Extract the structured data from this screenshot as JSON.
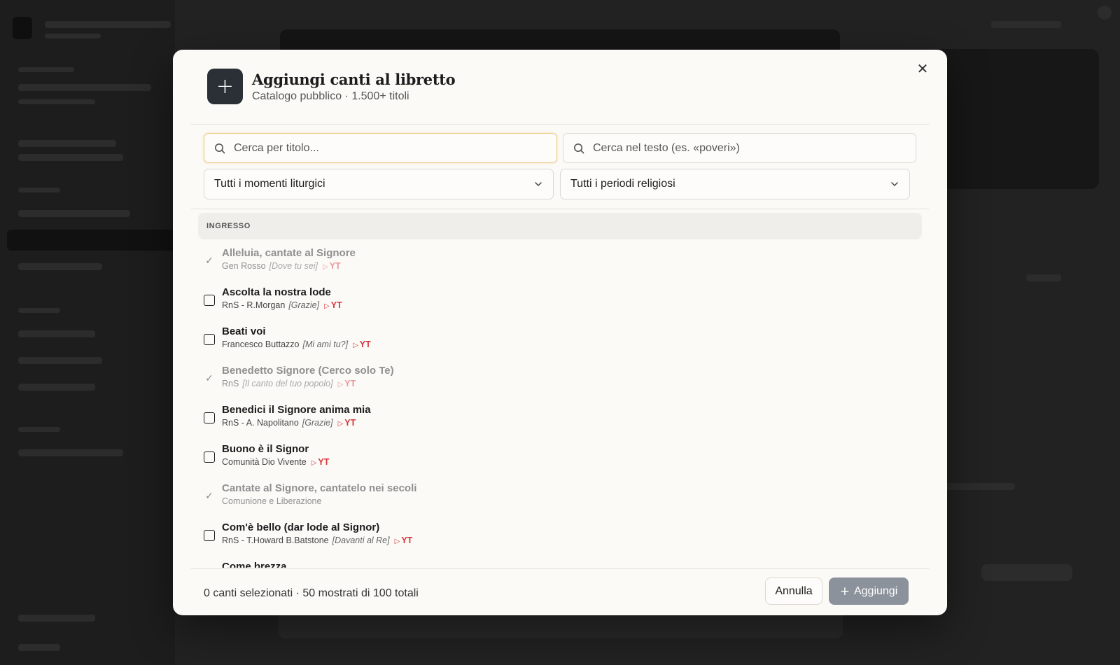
{
  "modal": {
    "title": "Aggiungi canti al libretto",
    "subtitle": "Catalogo pubblico · 1.500+ titoli",
    "header_icon": "plus-icon",
    "close_icon": "close-icon"
  },
  "search": {
    "title_placeholder": "Cerca per titolo...",
    "text_placeholder": "Cerca nel testo (es. «poveri»)"
  },
  "filters": {
    "moment": "Tutti i momenti liturgici",
    "period": "Tutti i periodi religiosi"
  },
  "section": {
    "label": "INGRESSO"
  },
  "yt_label": "YT",
  "songs": [
    {
      "title": "Alleluia, cantate al Signore",
      "author": "Gen Rosso",
      "album": "[Dove tu sei]",
      "yt": "YT",
      "state": "added"
    },
    {
      "title": "Ascolta la nostra lode",
      "author": "RnS - R.Morgan",
      "album": "[Grazie]",
      "yt": "YT",
      "state": "unchecked"
    },
    {
      "title": "Beati voi",
      "author": "Francesco Buttazzo",
      "album": "[Mi ami tu?]",
      "yt": "YT",
      "state": "unchecked"
    },
    {
      "title": "Benedetto Signore (Cerco solo Te)",
      "author": "RnS",
      "album": "[Il canto del tuo popolo]",
      "yt": "YT",
      "state": "added"
    },
    {
      "title": "Benedici il Signore anima mia",
      "author": "RnS - A. Napolitano",
      "album": "[Grazie]",
      "yt": "YT",
      "state": "unchecked"
    },
    {
      "title": "Buono è il Signor",
      "author": "Comunità Dio Vivente",
      "album": "",
      "yt": "YT",
      "state": "unchecked"
    },
    {
      "title": "Cantate al Signore, cantatelo nei secoli",
      "author": "Comunione e Liberazione",
      "album": "",
      "yt": "",
      "state": "added"
    },
    {
      "title": "Com'è bello (dar lode al Signor)",
      "author": "RnS - T.Howard B.Batstone",
      "album": "[Davanti al Re]",
      "yt": "YT",
      "state": "unchecked"
    },
    {
      "title": "Come brezza",
      "author": "",
      "album": "",
      "yt": "",
      "state": "unchecked"
    }
  ],
  "footer": {
    "status": "0 canti selezionati · 50 mostrati di 100 totali",
    "cancel_label": "Annulla",
    "add_label": "Aggiungi"
  },
  "colors": {
    "accent_dark": "#2b2f36",
    "youtube_red": "#d6373a",
    "focus_border": "#e8c983",
    "disabled_button": "#8c929b"
  }
}
